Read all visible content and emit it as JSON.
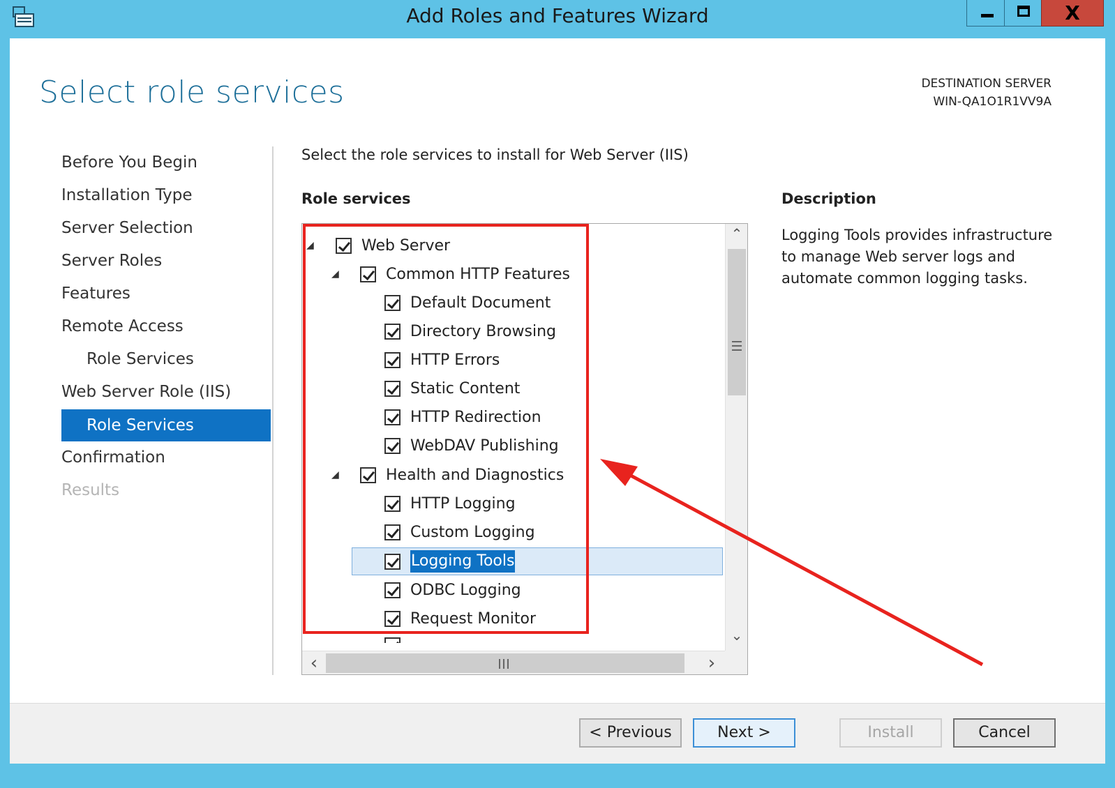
{
  "window": {
    "title": "Add Roles and Features Wizard",
    "close_glyph": "X",
    "accent_color": "#5ec2e6"
  },
  "header": {
    "page_title": "Select role services",
    "destination_label": "DESTINATION SERVER",
    "destination_server": "WIN-QA1O1R1VV9A"
  },
  "nav": {
    "items": [
      {
        "label": "Before You Begin"
      },
      {
        "label": "Installation Type"
      },
      {
        "label": "Server Selection"
      },
      {
        "label": "Server Roles"
      },
      {
        "label": "Features"
      },
      {
        "label": "Remote Access"
      },
      {
        "label": "Role Services"
      },
      {
        "label": "Web Server Role (IIS)"
      },
      {
        "label": "Role Services"
      },
      {
        "label": "Confirmation"
      },
      {
        "label": "Results"
      }
    ]
  },
  "main": {
    "intro": "Select the role services to install for Web Server (IIS)",
    "role_services_header": "Role services",
    "description_header": "Description",
    "description_text": "Logging Tools provides infrastructure to manage Web server logs and automate common logging tasks."
  },
  "tree": {
    "items": [
      {
        "label": "Web Server",
        "checked": true,
        "expander": "◢"
      },
      {
        "label": "Common HTTP Features",
        "checked": true,
        "expander": "◢"
      },
      {
        "label": "Default Document",
        "checked": true
      },
      {
        "label": "Directory Browsing",
        "checked": true
      },
      {
        "label": "HTTP Errors",
        "checked": true
      },
      {
        "label": "Static Content",
        "checked": true
      },
      {
        "label": "HTTP Redirection",
        "checked": true
      },
      {
        "label": "WebDAV Publishing",
        "checked": true
      },
      {
        "label": "Health and Diagnostics",
        "checked": true,
        "expander": "◢"
      },
      {
        "label": "HTTP Logging",
        "checked": true
      },
      {
        "label": "Custom Logging",
        "checked": true
      },
      {
        "label": "Logging Tools",
        "checked": true,
        "selected": true
      },
      {
        "label": "ODBC Logging",
        "checked": true
      },
      {
        "label": "Request Monitor",
        "checked": true
      }
    ],
    "up_arrow": "⌃",
    "down_arrow": "⌄",
    "left_arrow": "‹",
    "right_arrow": "›"
  },
  "annotations": {
    "highlight_color": "#e8231e"
  },
  "footer": {
    "previous_label": "< Previous",
    "next_label": "Next >",
    "install_label": "Install",
    "cancel_label": "Cancel"
  }
}
